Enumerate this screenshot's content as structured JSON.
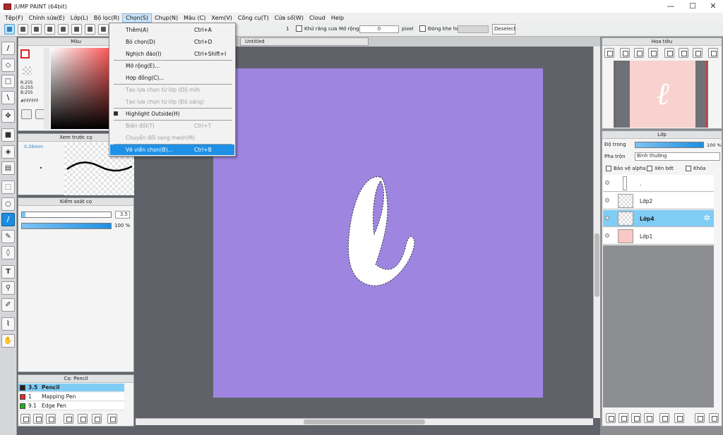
{
  "window": {
    "title": "JUMP PAINT (64bit)",
    "minimize": "—",
    "maximize": "☐",
    "close": "✕"
  },
  "menubar": [
    "Tệp(F)",
    "Chỉnh sửa(E)",
    "Lớp(L)",
    "Bộ lọc(R)",
    "Chọn(S)",
    "Chụp(N)",
    "Màu (C)",
    "Xem(V)",
    "Công cụ(T)",
    "Cửa sổ(W)",
    "Cloud",
    "Help"
  ],
  "toolbar": {
    "brush_size": "1",
    "antialias_label": "Khử răng cưa",
    "expand_label": "Mở rộng",
    "expand_value": "0",
    "expand_unit": "pixel",
    "close_gap_label": "Đóng khe hở",
    "deselect": "Deselect"
  },
  "select_menu": [
    {
      "label": "Thêm(A)",
      "shortcut": "Ctrl+A",
      "disabled": false
    },
    {
      "label": "Bỏ chọn(D)",
      "shortcut": "Ctrl+D",
      "disabled": false
    },
    {
      "label": "Nghịch đảo(I)",
      "shortcut": "Ctrl+Shift+I",
      "disabled": false
    },
    {
      "label": "Mở rộng(E)...",
      "shortcut": "",
      "disabled": false
    },
    {
      "label": "Hợp đồng(C)...",
      "shortcut": "",
      "disabled": false
    },
    {
      "label": "Tạo lựa chọn từ lớp (Độ mờ)",
      "shortcut": "",
      "disabled": true
    },
    {
      "label": "Tạo lựa chọn từ lớp (Độ sáng)",
      "shortcut": "",
      "disabled": true
    },
    {
      "label": "Highlight Outside(H)",
      "shortcut": "",
      "disabled": false
    },
    {
      "label": "Biến đổi(T)",
      "shortcut": "Ctrl+T",
      "disabled": true
    },
    {
      "label": "Chuyển đổi sang mesh(M)",
      "shortcut": "",
      "disabled": true
    },
    {
      "label": "Vẽ viền chọn(B)...",
      "shortcut": "Ctrl+B",
      "disabled": false
    }
  ],
  "color_panel": {
    "title": "Màu",
    "r": "R:255",
    "g": "G:255",
    "b": "B:255",
    "hex": "#FFFFFF"
  },
  "brush_preview": {
    "title": "Xem trước cọ",
    "size": "0.26mm"
  },
  "brush_control": {
    "title": "Kiểm soát cọ",
    "size": "3.5",
    "opacity": "100 %",
    "opacity_level": 1.0
  },
  "brush_list": {
    "title": "Cọ: Pencil",
    "items": [
      {
        "size": "3.5",
        "name": "Pencil",
        "color": "#222222",
        "selected": true
      },
      {
        "size": "1",
        "name": "Mapping Pen",
        "color": "#e03030",
        "selected": false
      },
      {
        "size": "9.1",
        "name": "Edge Pen",
        "color": "#20b020",
        "selected": false
      }
    ]
  },
  "canvas": {
    "tab": "Untitled",
    "bg_color": "#9d85e0"
  },
  "navigator": {
    "title": "Hoa tiêu"
  },
  "layers": {
    "title": "Lớp",
    "opacity_label": "Độ trong",
    "opacity_value": "100 %",
    "blend_label": "Pha trộn",
    "blend_value": "Bình thường",
    "protect_alpha": "Bảo vệ alpha",
    "clip": "Xén bớt",
    "lock": "Khóa",
    "items": [
      {
        "name": ".",
        "selected": false,
        "thumb": "folder"
      },
      {
        "name": "Lớp2",
        "selected": false,
        "thumb": "transparent"
      },
      {
        "name": "Lớp4",
        "selected": true,
        "thumb": "transparent"
      },
      {
        "name": "Lớp1",
        "selected": false,
        "thumb": "#f8c8c6"
      }
    ]
  },
  "left_tools": [
    "brush-icon",
    "eraser-icon",
    "rectangle-icon",
    "line-icon",
    "move-icon",
    "fill-rect-icon",
    "bucket-icon",
    "gradient-icon",
    "select-rect-icon",
    "lasso-icon",
    "pen-icon",
    "select-pen-icon",
    "select-eraser-icon",
    "text-icon",
    "magic-wand-icon",
    "ruler-icon",
    "eyedropper-icon",
    "hand-icon"
  ]
}
